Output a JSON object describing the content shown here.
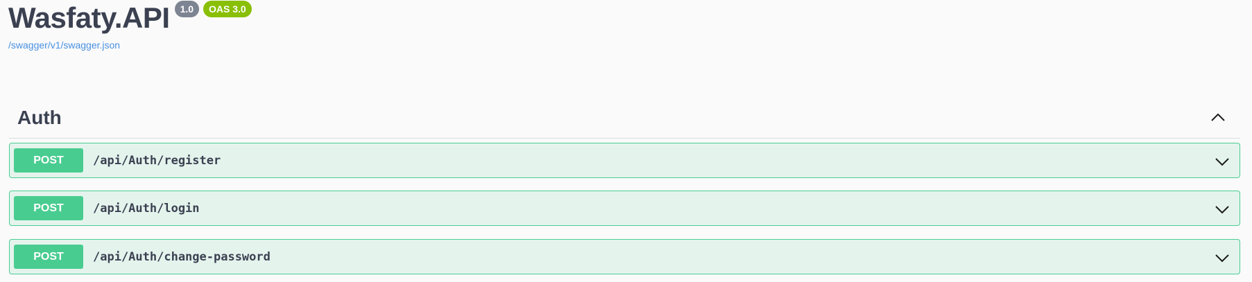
{
  "info": {
    "title": "Wasfaty.API",
    "version_badge": "1.0",
    "oas_badge": "OAS 3.0",
    "spec_link": "/swagger/v1/swagger.json"
  },
  "tag": {
    "name": "Auth",
    "expanded": true,
    "operations": [
      {
        "method": "POST",
        "path": "/api/Auth/register"
      },
      {
        "method": "POST",
        "path": "/api/Auth/login"
      },
      {
        "method": "POST",
        "path": "/api/Auth/change-password"
      }
    ]
  },
  "colors": {
    "post": "#49cc90",
    "text": "#3b4151",
    "link": "#4990e2",
    "version_badge": "#7d8492",
    "oas_badge": "#89bf04"
  },
  "icons": {
    "collapse": "chevron-up-icon",
    "expand": "chevron-down-icon"
  }
}
